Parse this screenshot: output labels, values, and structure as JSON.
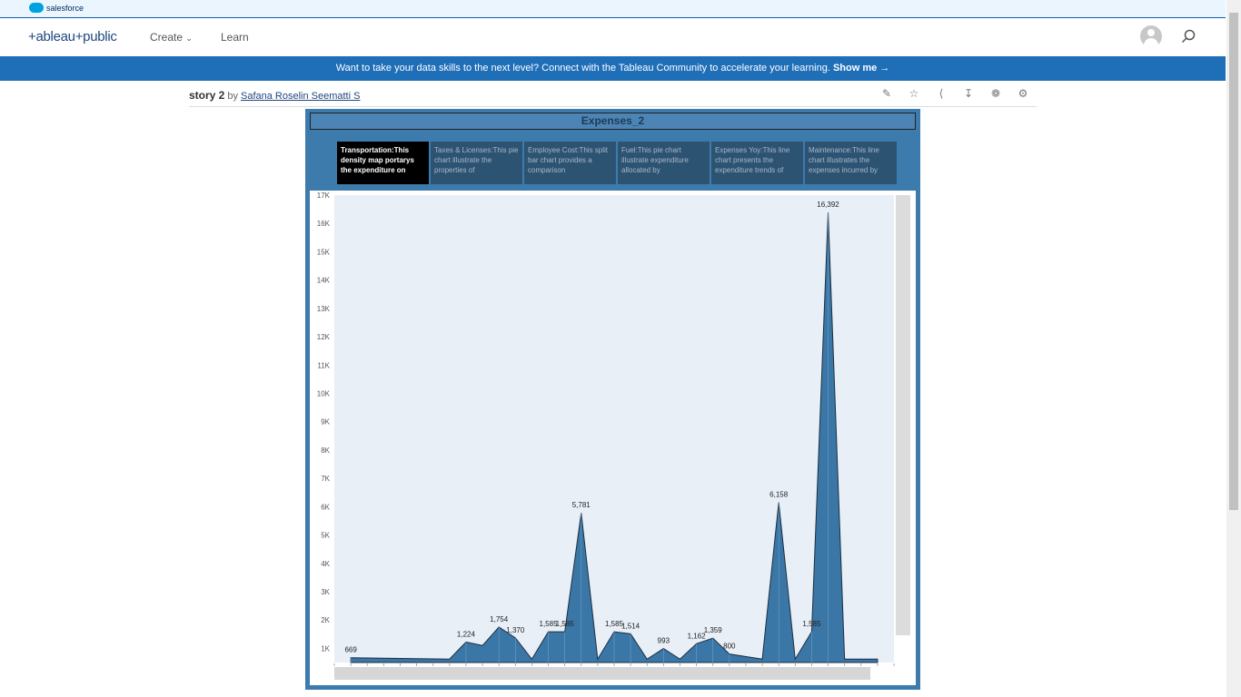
{
  "salesforce": {
    "label": "salesforce"
  },
  "nav": {
    "logo": "+ableau+public",
    "create": "Create",
    "learn": "Learn"
  },
  "banner": {
    "text": "Want to take your data skills to the next level? Connect with the Tableau Community to accelerate your learning. ",
    "link": "Show me →"
  },
  "viz_header": {
    "title": "story 2",
    "by": "by",
    "author": "Safana Roselin Seematti S"
  },
  "story": {
    "title": "Expenses_2",
    "points": [
      {
        "label": "Transportation:This density map portarys the expenditure on",
        "active": true
      },
      {
        "label": "Taxes & Licenses:This pie chart illustrate the properties of",
        "active": false
      },
      {
        "label": "Employee Cost:This split bar chart provides a comparison",
        "active": false
      },
      {
        "label": "Fuel:This pie chart illustrate expenditure allocated by",
        "active": false
      },
      {
        "label": "Expenses Yoy:This line chart presents the expenditure trends of",
        "active": false
      },
      {
        "label": "Maintenance:This line chart illustrates the expenses incurred by",
        "active": false
      }
    ]
  },
  "colors": {
    "accent": "#1f6eb8",
    "area": "#3a76a6",
    "viz_bg": "#3d7bad"
  },
  "chart_data": {
    "type": "area",
    "ylim": [
      500,
      17000
    ],
    "yticks": [
      "1K",
      "2K",
      "3K",
      "4K",
      "5K",
      "6K",
      "7K",
      "8K",
      "9K",
      "10K",
      "11K",
      "12K",
      "13K",
      "14K",
      "15K",
      "16K",
      "17K"
    ],
    "points": [
      {
        "x": 1,
        "y": 669,
        "label": "669"
      },
      {
        "x": 7,
        "y": 620
      },
      {
        "x": 8,
        "y": 1224,
        "label": "1,224"
      },
      {
        "x": 9,
        "y": 1100
      },
      {
        "x": 10,
        "y": 1754,
        "label": "1,754"
      },
      {
        "x": 11,
        "y": 1370,
        "label": "1,370"
      },
      {
        "x": 12,
        "y": 620
      },
      {
        "x": 13,
        "y": 1585,
        "label": "1,585"
      },
      {
        "x": 14,
        "y": 1585,
        "label": "1,585"
      },
      {
        "x": 15,
        "y": 5781,
        "label": "5,781"
      },
      {
        "x": 16,
        "y": 620
      },
      {
        "x": 17,
        "y": 1585,
        "label": "1,585"
      },
      {
        "x": 18,
        "y": 1514,
        "label": "1,514"
      },
      {
        "x": 19,
        "y": 620
      },
      {
        "x": 20,
        "y": 993,
        "label": "993"
      },
      {
        "x": 21,
        "y": 620
      },
      {
        "x": 22,
        "y": 1162,
        "label": "1,162"
      },
      {
        "x": 23,
        "y": 1359,
        "label": "1,359"
      },
      {
        "x": 24,
        "y": 800,
        "label": "800"
      },
      {
        "x": 26,
        "y": 620
      },
      {
        "x": 27,
        "y": 6158,
        "label": "6,158"
      },
      {
        "x": 28,
        "y": 620
      },
      {
        "x": 29,
        "y": 1585,
        "label": "1,585"
      },
      {
        "x": 30,
        "y": 16392,
        "label": "16,392"
      },
      {
        "x": 31,
        "y": 620
      },
      {
        "x": 33,
        "y": 620
      }
    ]
  }
}
